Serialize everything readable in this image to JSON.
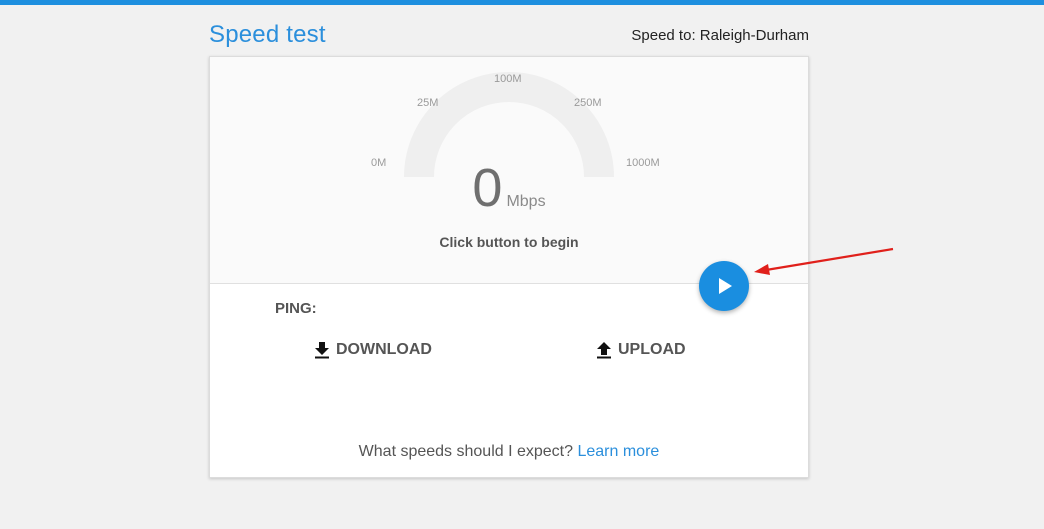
{
  "header": {
    "title": "Speed test",
    "speed_to": "Speed to: Raleigh-Durham"
  },
  "gauge": {
    "ticks": [
      "0M",
      "25M",
      "100M",
      "250M",
      "1000M"
    ],
    "value": "0",
    "unit": "Mbps",
    "hint": "Click button to begin"
  },
  "results": {
    "ping_label": "PING:",
    "download_label": "DOWNLOAD",
    "upload_label": "UPLOAD"
  },
  "footer": {
    "question": "What speeds should I expect?",
    "link": "Learn more"
  },
  "colors": {
    "accent": "#1a8ee0",
    "annotation": "#e0201b"
  },
  "icons": {
    "play": "play-icon",
    "download": "download-icon",
    "upload": "upload-icon"
  }
}
